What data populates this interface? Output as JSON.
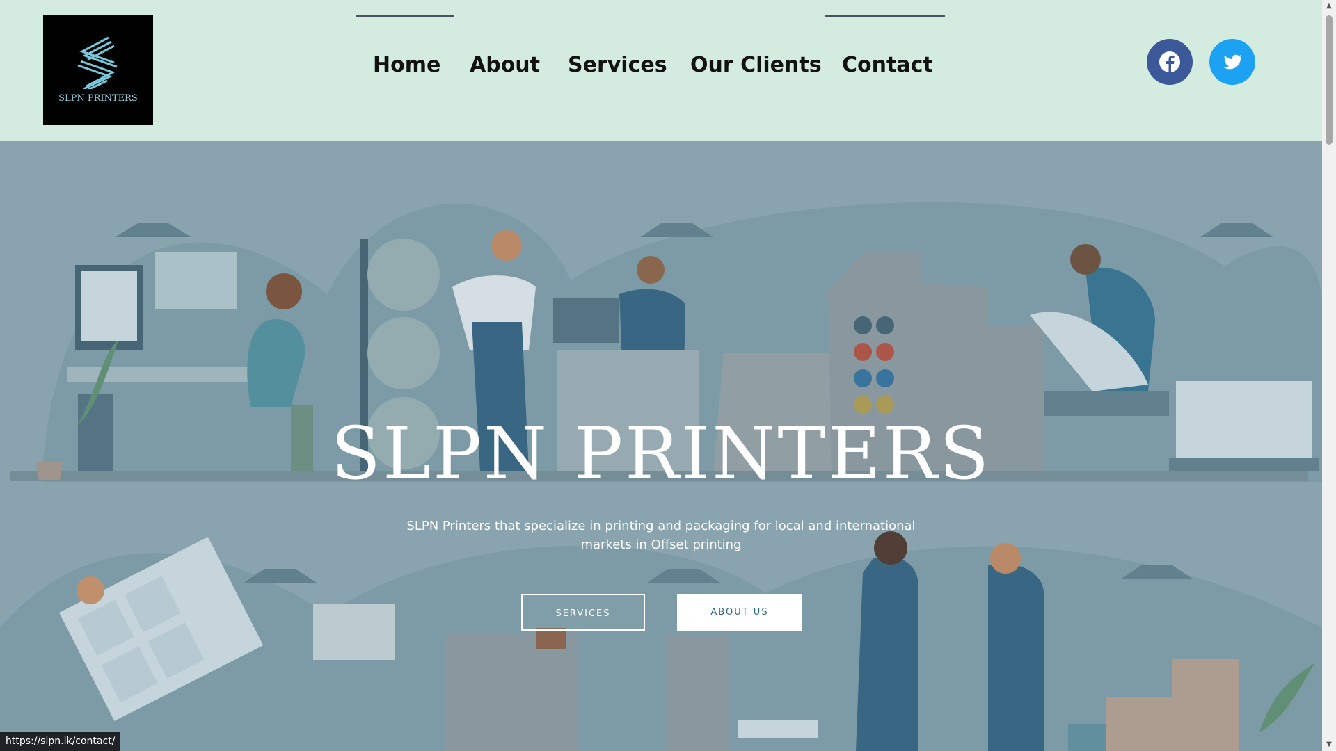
{
  "header": {
    "logo_text": "SLPN PRINTERS",
    "nav": [
      {
        "label": "Home",
        "active": true
      },
      {
        "label": "About",
        "active": false
      },
      {
        "label": "Services",
        "active": false
      },
      {
        "label": "Our Clients",
        "active": false
      },
      {
        "label": "Contact",
        "active": true
      }
    ],
    "social": [
      {
        "name": "facebook",
        "icon": "facebook-icon",
        "color": "#3b5998"
      },
      {
        "name": "twitter",
        "icon": "twitter-icon",
        "color": "#1da1f2"
      }
    ]
  },
  "hero": {
    "title": "SLPN PRINTERS",
    "subtitle": "SLPN Printers that specialize in printing and packaging for local and international markets in Offset printing",
    "buttons": {
      "services": "SERVICES",
      "about": "ABOUT US"
    }
  },
  "status_bar": {
    "url": "https://slpn.lk/contact/"
  },
  "colors": {
    "header_bg": "#d3ecdf",
    "hero_bg": "#8ea9b3",
    "nav_text": "#111111",
    "about_button_text": "#2f6a84"
  }
}
